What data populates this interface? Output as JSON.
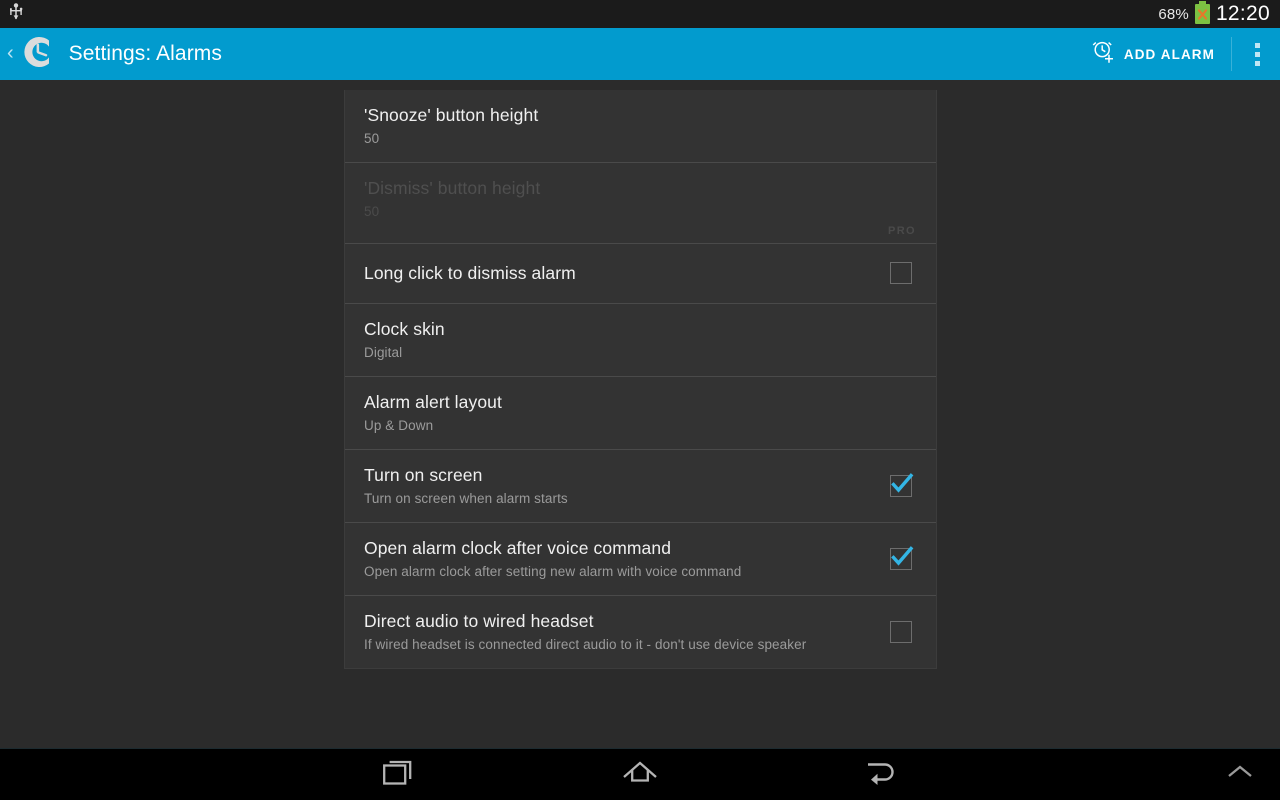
{
  "status_bar": {
    "usb_icon": "usb-icon",
    "battery_percent": "68%",
    "battery_icon": "battery-unknown-icon",
    "battery_color": "#7cc142",
    "battery_mark_color": "#e8782a",
    "clock": "12:20"
  },
  "action_bar": {
    "back_chevron": "‹",
    "logo_icon": "clock-app-logo-icon",
    "title": "Settings: Alarms",
    "add_alarm": {
      "icon": "alarm-add-icon",
      "label": "ADD ALARM"
    },
    "overflow_icon": "overflow-menu-icon",
    "accent_color": "#029bce"
  },
  "settings": {
    "items": [
      {
        "title": "'Snooze' button height",
        "summary": "50",
        "control": "none",
        "disabled": false,
        "badge": ""
      },
      {
        "title": "'Dismiss' button height",
        "summary": "50",
        "control": "none",
        "disabled": true,
        "badge": "PRO"
      },
      {
        "title": "Long click to dismiss alarm",
        "summary": "",
        "control": "checkbox",
        "checked": false,
        "disabled": false,
        "badge": ""
      },
      {
        "title": "Clock skin",
        "summary": "Digital",
        "control": "none",
        "disabled": false,
        "badge": ""
      },
      {
        "title": "Alarm alert layout",
        "summary": "Up & Down",
        "control": "none",
        "disabled": false,
        "badge": ""
      },
      {
        "title": "Turn on screen",
        "summary": "Turn on screen when alarm starts",
        "control": "checkbox",
        "checked": true,
        "disabled": false,
        "badge": ""
      },
      {
        "title": "Open alarm clock after voice command",
        "summary": "Open alarm clock after setting new alarm with voice command",
        "control": "checkbox",
        "checked": true,
        "disabled": false,
        "badge": ""
      },
      {
        "title": "Direct audio to wired headset",
        "summary": "If wired headset is connected direct audio to it - don't use device speaker",
        "control": "checkbox",
        "checked": false,
        "disabled": false,
        "badge": ""
      }
    ],
    "checkbox_checked_color": "#33b5e5"
  },
  "nav_bar": {
    "recents_icon": "recents-icon",
    "home_icon": "home-icon",
    "back_icon": "back-icon",
    "expand_icon": "chevron-up-icon"
  }
}
